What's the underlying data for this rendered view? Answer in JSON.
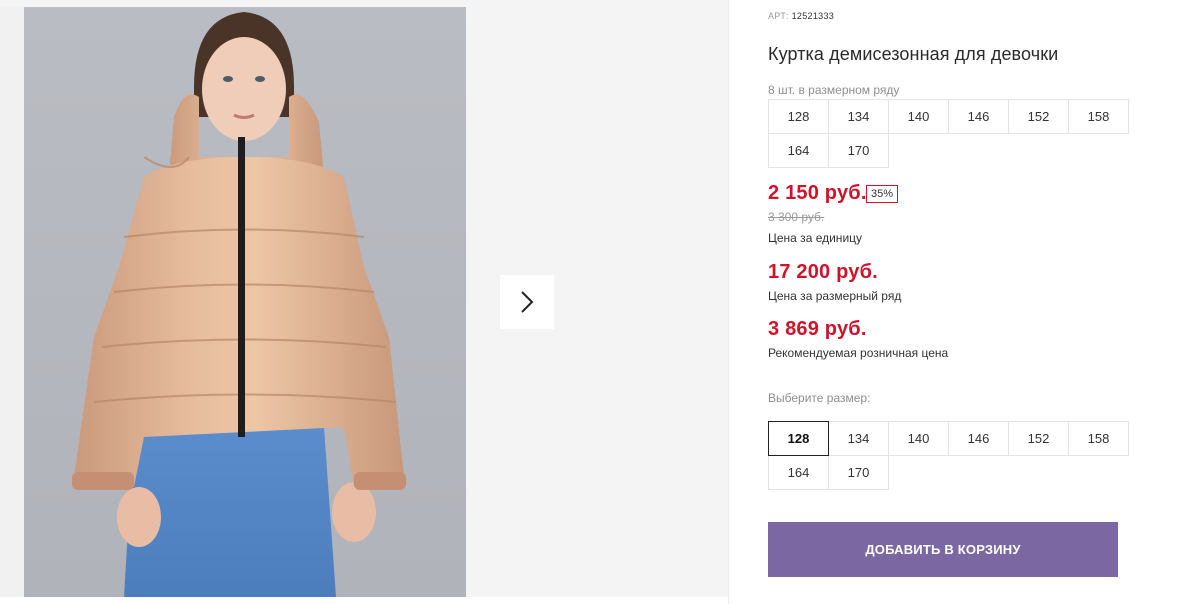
{
  "gallery": {
    "next_icon": "chevron-right-icon",
    "photo_alt": "Girl wearing beige puffer jacket"
  },
  "product": {
    "art_label": "АРТ:",
    "art_number": "12521333",
    "title": "Куртка демисезонная для девочки",
    "pack_note": "8 шт. в размерном ряду",
    "pack_sizes": [
      "128",
      "134",
      "140",
      "146",
      "152",
      "158",
      "164",
      "170"
    ],
    "unit_price": "2 150 руб.",
    "discount": "35%",
    "old_price": "3 300 руб.",
    "unit_price_caption": "Цена за единицу",
    "pack_price": "17 200 руб.",
    "pack_price_caption": "Цена за размерный ряд",
    "retail_price": "3 869 руб.",
    "retail_price_caption": "Рекомендуемая розничная цена",
    "choose_size_label": "Выберите размер:",
    "size_options": [
      "128",
      "134",
      "140",
      "146",
      "152",
      "158",
      "164",
      "170"
    ],
    "selected_size": "128",
    "add_to_cart_label": "ДОБАВИТЬ В КОРЗИНУ"
  },
  "colors": {
    "price_red": "#d0122b",
    "button_purple": "#7b68a3"
  }
}
